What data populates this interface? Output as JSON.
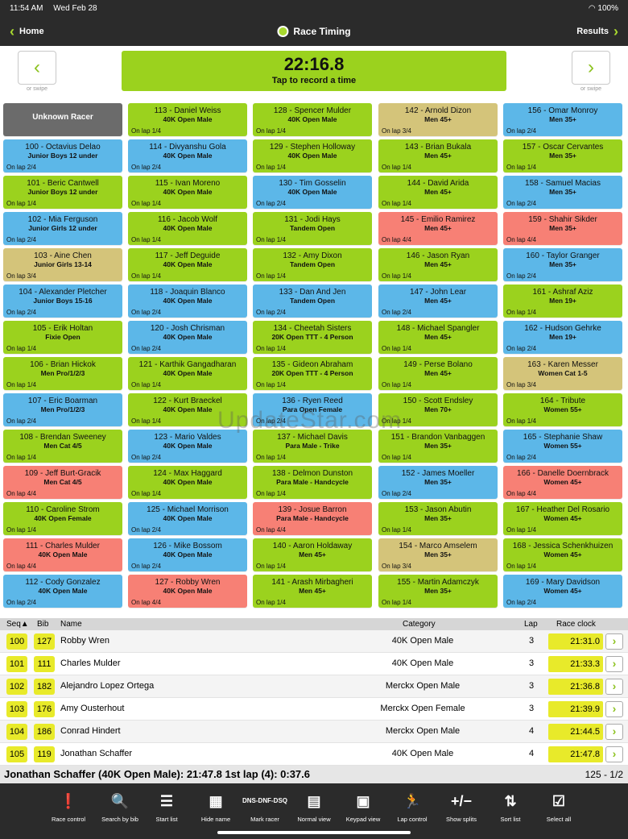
{
  "status": {
    "time": "11:54 AM",
    "date": "Wed Feb 28",
    "battery": "100%"
  },
  "nav": {
    "back_label": "Home",
    "title": "Race Timing",
    "results_label": "Results"
  },
  "timer": {
    "value": "22:16.8",
    "prompt": "Tap to record a time",
    "swipe_hint": "or swipe"
  },
  "watermark": "UpdateStar.com",
  "tiles": [
    [
      {
        "name": "Unknown Racer",
        "cat": "",
        "lap": "",
        "color": "gray"
      },
      {
        "name": "100 - Octavius Delao",
        "cat": "Junior Boys 12 under",
        "lap": "On lap 2/4",
        "color": "blue"
      },
      {
        "name": "101 - Beric Cantwell",
        "cat": "Junior Boys 12 under",
        "lap": "On lap 1/4",
        "color": "green"
      },
      {
        "name": "102 - Mia Ferguson",
        "cat": "Junior Girls 12 under",
        "lap": "On lap 2/4",
        "color": "blue"
      },
      {
        "name": "103 - Aine Chen",
        "cat": "Junior Girls 13-14",
        "lap": "On lap 3/4",
        "color": "tan"
      },
      {
        "name": "104 - Alexander Pletcher",
        "cat": "Junior Boys 15-16",
        "lap": "On lap 2/4",
        "color": "blue"
      },
      {
        "name": "105 - Erik Holtan",
        "cat": "Fixie Open",
        "lap": "On lap 1/4",
        "color": "green"
      },
      {
        "name": "106 - Brian Hickok",
        "cat": "Men Pro/1/2/3",
        "lap": "On lap 1/4",
        "color": "green"
      },
      {
        "name": "107 - Eric Boarman",
        "cat": "Men Pro/1/2/3",
        "lap": "On lap 2/4",
        "color": "blue"
      },
      {
        "name": "108 - Brendan Sweeney",
        "cat": "Men Cat 4/5",
        "lap": "On lap 1/4",
        "color": "green"
      },
      {
        "name": "109 - Jeff Burt-Gracik",
        "cat": "Men Cat 4/5",
        "lap": "On lap 4/4",
        "color": "red"
      },
      {
        "name": "110 - Caroline Strom",
        "cat": "40K Open Female",
        "lap": "On lap 1/4",
        "color": "green"
      },
      {
        "name": "111 - Charles Mulder",
        "cat": "40K Open Male",
        "lap": "On lap 4/4",
        "color": "red"
      },
      {
        "name": "112 - Cody Gonzalez",
        "cat": "40K Open Male",
        "lap": "On lap 2/4",
        "color": "blue"
      }
    ],
    [
      {
        "name": "113 - Daniel Weiss",
        "cat": "40K Open Male",
        "lap": "On lap 1/4",
        "color": "green"
      },
      {
        "name": "114 - Divyanshu Gola",
        "cat": "40K Open Male",
        "lap": "On lap 2/4",
        "color": "blue"
      },
      {
        "name": "115 - Ivan Moreno",
        "cat": "40K Open Male",
        "lap": "On lap 1/4",
        "color": "green"
      },
      {
        "name": "116 - Jacob Wolf",
        "cat": "40K Open Male",
        "lap": "On lap 1/4",
        "color": "green"
      },
      {
        "name": "117 - Jeff Deguide",
        "cat": "40K Open Male",
        "lap": "On lap 1/4",
        "color": "green"
      },
      {
        "name": "118 - Joaquin Blanco",
        "cat": "40K Open Male",
        "lap": "On lap 2/4",
        "color": "blue"
      },
      {
        "name": "120 - Josh Chrisman",
        "cat": "40K Open Male",
        "lap": "On lap 2/4",
        "color": "blue"
      },
      {
        "name": "121 - Karthik Gangadharan",
        "cat": "40K Open Male",
        "lap": "On lap 1/4",
        "color": "green"
      },
      {
        "name": "122 - Kurt Braeckel",
        "cat": "40K Open Male",
        "lap": "On lap 1/4",
        "color": "green"
      },
      {
        "name": "123 - Mario Valdes",
        "cat": "40K Open Male",
        "lap": "On lap 2/4",
        "color": "blue"
      },
      {
        "name": "124 - Max Haggard",
        "cat": "40K Open Male",
        "lap": "On lap 1/4",
        "color": "green"
      },
      {
        "name": "125 - Michael Morrison",
        "cat": "40K Open Male",
        "lap": "On lap 2/4",
        "color": "blue"
      },
      {
        "name": "126 - Mike Bossom",
        "cat": "40K Open Male",
        "lap": "On lap 2/4",
        "color": "blue"
      },
      {
        "name": "127 - Robby Wren",
        "cat": "40K Open Male",
        "lap": "On lap 4/4",
        "color": "red"
      }
    ],
    [
      {
        "name": "128 - Spencer Mulder",
        "cat": "40K Open Male",
        "lap": "On lap 1/4",
        "color": "green"
      },
      {
        "name": "129 - Stephen Holloway",
        "cat": "40K Open Male",
        "lap": "On lap 1/4",
        "color": "green"
      },
      {
        "name": "130 - Tim Gosselin",
        "cat": "40K Open Male",
        "lap": "On lap 2/4",
        "color": "blue"
      },
      {
        "name": "131 - Jodi Hays",
        "cat": "Tandem Open",
        "lap": "On lap 1/4",
        "color": "green"
      },
      {
        "name": "132 - Amy Dixon",
        "cat": "Tandem Open",
        "lap": "On lap 1/4",
        "color": "green"
      },
      {
        "name": "133 - Dan And Jen",
        "cat": "Tandem Open",
        "lap": "On lap 2/4",
        "color": "blue"
      },
      {
        "name": "134 - Cheetah Sisters",
        "cat": "20K Open TTT - 4 Person",
        "lap": "On lap 1/4",
        "color": "green"
      },
      {
        "name": "135 - Gideon Abraham",
        "cat": "20K Open TTT - 4 Person",
        "lap": "On lap 1/4",
        "color": "green"
      },
      {
        "name": "136 - Ryen Reed",
        "cat": "Para Open Female",
        "lap": "On lap 2/4",
        "color": "blue"
      },
      {
        "name": "137 - Michael Davis",
        "cat": "Para Male - Trike",
        "lap": "On lap 1/4",
        "color": "green"
      },
      {
        "name": "138 - Delmon Dunston",
        "cat": "Para Male - Handcycle",
        "lap": "On lap 1/4",
        "color": "green"
      },
      {
        "name": "139 - Josue Barron",
        "cat": "Para Male - Handcycle",
        "lap": "On lap 4/4",
        "color": "red"
      },
      {
        "name": "140 - Aaron Holdaway",
        "cat": "Men 45+",
        "lap": "On lap 1/4",
        "color": "green"
      },
      {
        "name": "141 - Arash Mirbagheri",
        "cat": "Men 45+",
        "lap": "On lap 1/4",
        "color": "green"
      }
    ],
    [
      {
        "name": "142 - Arnold Dizon",
        "cat": "Men 45+",
        "lap": "On lap 3/4",
        "color": "tan"
      },
      {
        "name": "143 - Brian Bukala",
        "cat": "Men 45+",
        "lap": "On lap 1/4",
        "color": "green"
      },
      {
        "name": "144 - David Arida",
        "cat": "Men 45+",
        "lap": "On lap 1/4",
        "color": "green"
      },
      {
        "name": "145 - Emilio Ramirez",
        "cat": "Men 45+",
        "lap": "On lap 4/4",
        "color": "red"
      },
      {
        "name": "146 - Jason Ryan",
        "cat": "Men 45+",
        "lap": "On lap 1/4",
        "color": "green"
      },
      {
        "name": "147 - John Lear",
        "cat": "Men 45+",
        "lap": "On lap 2/4",
        "color": "blue"
      },
      {
        "name": "148 - Michael Spangler",
        "cat": "Men 45+",
        "lap": "On lap 1/4",
        "color": "green"
      },
      {
        "name": "149 - Perse Bolano",
        "cat": "Men 45+",
        "lap": "On lap 1/4",
        "color": "green"
      },
      {
        "name": "150 - Scott Endsley",
        "cat": "Men 70+",
        "lap": "On lap 1/4",
        "color": "green"
      },
      {
        "name": "151 - Brandon Vanbaggen",
        "cat": "Men 35+",
        "lap": "On lap 1/4",
        "color": "green"
      },
      {
        "name": "152 - James Moeller",
        "cat": "Men 35+",
        "lap": "On lap 2/4",
        "color": "blue"
      },
      {
        "name": "153 - Jason Abutin",
        "cat": "Men 35+",
        "lap": "On lap 1/4",
        "color": "green"
      },
      {
        "name": "154 - Marco Amselem",
        "cat": "Men 35+",
        "lap": "On lap 3/4",
        "color": "tan"
      },
      {
        "name": "155 - Martin Adamczyk",
        "cat": "Men 35+",
        "lap": "On lap 1/4",
        "color": "green"
      }
    ],
    [
      {
        "name": "156 - Omar Monroy",
        "cat": "Men 35+",
        "lap": "On lap 2/4",
        "color": "blue"
      },
      {
        "name": "157 - Oscar Cervantes",
        "cat": "Men 35+",
        "lap": "On lap 1/4",
        "color": "green"
      },
      {
        "name": "158 - Samuel Macias",
        "cat": "Men 35+",
        "lap": "On lap 2/4",
        "color": "blue"
      },
      {
        "name": "159 - Shahir Sikder",
        "cat": "Men 35+",
        "lap": "On lap 4/4",
        "color": "red"
      },
      {
        "name": "160 - Taylor Granger",
        "cat": "Men 35+",
        "lap": "On lap 2/4",
        "color": "blue"
      },
      {
        "name": "161 - Ashraf Aziz",
        "cat": "Men 19+",
        "lap": "On lap 1/4",
        "color": "green"
      },
      {
        "name": "162 - Hudson Gehrke",
        "cat": "Men 19+",
        "lap": "On lap 2/4",
        "color": "blue"
      },
      {
        "name": "163 - Karen Messer",
        "cat": "Women Cat 1-5",
        "lap": "On lap 3/4",
        "color": "tan"
      },
      {
        "name": "164 - Tribute",
        "cat": "Women 55+",
        "lap": "On lap 1/4",
        "color": "green"
      },
      {
        "name": "165 - Stephanie Shaw",
        "cat": "Women 55+",
        "lap": "On lap 2/4",
        "color": "blue"
      },
      {
        "name": "166 - Danelle Doernbrack",
        "cat": "Women 45+",
        "lap": "On lap 4/4",
        "color": "red"
      },
      {
        "name": "167 - Heather Del Rosario",
        "cat": "Women 45+",
        "lap": "On lap 1/4",
        "color": "green"
      },
      {
        "name": "168 - Jessica Schenkhuizen",
        "cat": "Women 45+",
        "lap": "On lap 1/4",
        "color": "green"
      },
      {
        "name": "169 - Mary Davidson",
        "cat": "Women 45+",
        "lap": "On lap 2/4",
        "color": "blue"
      }
    ]
  ],
  "list": {
    "headers": {
      "seq": "Seq▲",
      "bib": "Bib",
      "name": "Name",
      "category": "Category",
      "lap": "Lap",
      "clock": "Race clock"
    },
    "rows": [
      {
        "seq": "100",
        "bib": "127",
        "name": "Robby Wren",
        "category": "40K Open Male",
        "lap": "3",
        "clock": "21:31.0"
      },
      {
        "seq": "101",
        "bib": "111",
        "name": "Charles Mulder",
        "category": "40K Open Male",
        "lap": "3",
        "clock": "21:33.3"
      },
      {
        "seq": "102",
        "bib": "182",
        "name": "Alejandro Lopez Ortega",
        "category": "Merckx Open Male",
        "lap": "3",
        "clock": "21:36.8"
      },
      {
        "seq": "103",
        "bib": "176",
        "name": "Amy Ousterhout",
        "category": "Merckx Open Female",
        "lap": "3",
        "clock": "21:39.9"
      },
      {
        "seq": "104",
        "bib": "186",
        "name": "Conrad Hindert",
        "category": "Merckx Open Male",
        "lap": "4",
        "clock": "21:44.5"
      },
      {
        "seq": "105",
        "bib": "119",
        "name": "Jonathan Schaffer",
        "category": "40K Open Male",
        "lap": "4",
        "clock": "21:47.8"
      }
    ]
  },
  "summary": {
    "text": "Jonathan Schaffer (40K Open Male): 21:47.8 1st lap (4): 0:37.6",
    "page": "125 - 1/2"
  },
  "toolbar": [
    {
      "icon": "alert-icon",
      "glyph": "❗",
      "label": "Race control"
    },
    {
      "icon": "search-icon",
      "glyph": "🔍",
      "label": "Search by bib"
    },
    {
      "icon": "list-icon",
      "glyph": "☰",
      "label": "Start list"
    },
    {
      "icon": "grid-icon",
      "glyph": "▦",
      "label": "Hide name"
    },
    {
      "icon": "dns-icon",
      "glyph": "DNS-DNF-DSQ",
      "label": "Mark racer"
    },
    {
      "icon": "keypad-grid-icon",
      "glyph": "▤",
      "label": "Normal view"
    },
    {
      "icon": "calculator-icon",
      "glyph": "▣",
      "label": "Keypad view"
    },
    {
      "icon": "runner-icon",
      "glyph": "🏃",
      "label": "Lap control"
    },
    {
      "icon": "plus-minus-icon",
      "glyph": "+/−",
      "label": "Show splits"
    },
    {
      "icon": "sort-icon",
      "glyph": "⇅",
      "label": "Sort list"
    },
    {
      "icon": "select-all-icon",
      "glyph": "☑",
      "label": "Select all"
    }
  ]
}
